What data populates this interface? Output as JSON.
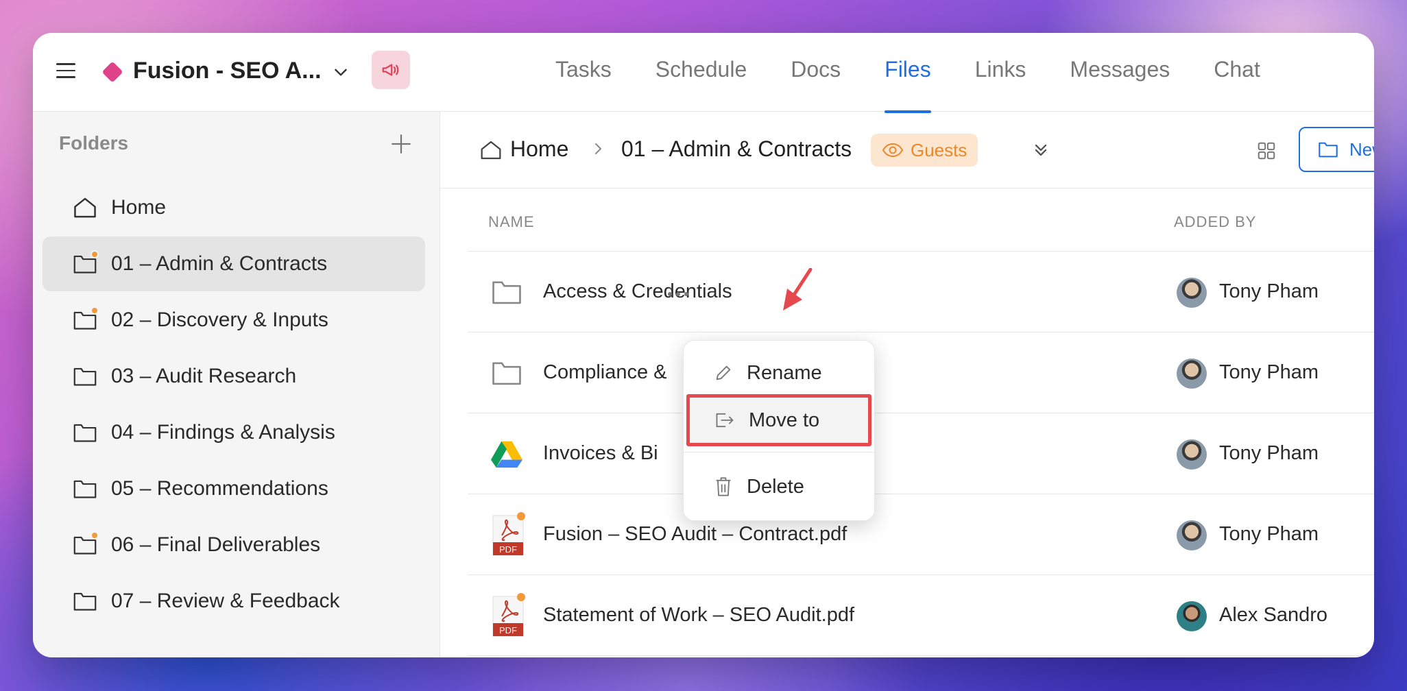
{
  "header": {
    "project_title": "Fusion - SEO A...",
    "tabs": [
      {
        "label": "Tasks"
      },
      {
        "label": "Schedule"
      },
      {
        "label": "Docs"
      },
      {
        "label": "Files",
        "active": true
      },
      {
        "label": "Links"
      },
      {
        "label": "Messages"
      },
      {
        "label": "Chat"
      }
    ]
  },
  "sidebar": {
    "heading": "Folders",
    "items": [
      {
        "label": "Home",
        "icon": "home-icon"
      },
      {
        "label": "01 – Admin & Contracts",
        "icon": "folder-icon",
        "badge": true,
        "active": true
      },
      {
        "label": "02 – Discovery & Inputs",
        "icon": "folder-icon",
        "badge": true
      },
      {
        "label": "03 – Audit Research",
        "icon": "folder-icon"
      },
      {
        "label": "04 – Findings & Analysis",
        "icon": "folder-icon"
      },
      {
        "label": "05 – Recommendations",
        "icon": "folder-icon"
      },
      {
        "label": "06 – Final Deliverables",
        "icon": "folder-icon",
        "badge": true
      },
      {
        "label": "07 – Review & Feedback",
        "icon": "folder-icon"
      }
    ]
  },
  "breadcrumb": {
    "home": "Home",
    "current": "01 – Admin & Contracts",
    "guests_label": "Guests"
  },
  "toolbar": {
    "new_folder_label": "New Fo"
  },
  "table": {
    "columns": {
      "name": "NAME",
      "added_by": "ADDED BY"
    },
    "rows": [
      {
        "name": "Access & Credentials",
        "type": "folder",
        "added_by": "Tony Pham"
      },
      {
        "name": "Compliance &",
        "type": "folder",
        "added_by": "Tony Pham"
      },
      {
        "name": "Invoices & Bi",
        "type": "google-drive",
        "added_by": "Tony Pham"
      },
      {
        "name": "Fusion – SEO Audit – Contract.pdf",
        "type": "pdf",
        "added_by": "Tony Pham"
      },
      {
        "name": "Statement of Work – SEO Audit.pdf",
        "type": "pdf",
        "added_by": "Alex Sandro"
      }
    ]
  },
  "context_menu": {
    "items": [
      {
        "label": "Rename",
        "icon": "pencil-icon"
      },
      {
        "label": "Move to",
        "icon": "move-icon",
        "highlighted": true
      },
      {
        "label": "Delete",
        "icon": "trash-icon"
      }
    ]
  },
  "pdf_label": "PDF",
  "colors": {
    "accent": "#1e6fe0",
    "project": "#e0428a",
    "guests_bg": "#fde6cf",
    "guests_text": "#e9892c",
    "highlight": "#e5484d",
    "badge": "#f29a3a"
  }
}
